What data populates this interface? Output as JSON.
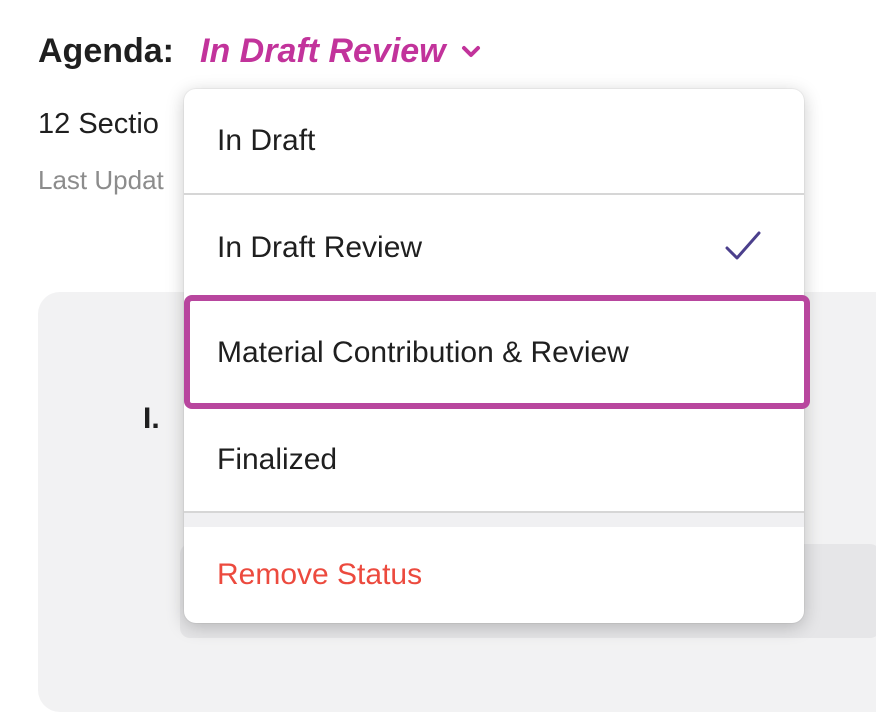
{
  "header": {
    "agenda_label": "Agenda:",
    "status_value": "In Draft Review",
    "chevron_icon": "chevron-down-icon",
    "accent_color": "#c2339b"
  },
  "summary": {
    "sections_text": "12 Sectio",
    "last_updated_text": "Last Updat"
  },
  "content": {
    "roman_numeral": "I."
  },
  "status_menu": {
    "options": [
      {
        "label": "In Draft",
        "selected": false
      },
      {
        "label": "In Draft Review",
        "selected": true
      },
      {
        "label": "Material Contribution & Review",
        "selected": false,
        "highlighted": true
      },
      {
        "label": "Finalized",
        "selected": false
      }
    ],
    "remove_label": "Remove Status",
    "check_icon": "checkmark-icon",
    "remove_color": "#ec4a3e",
    "highlight_color": "#b8469e"
  }
}
